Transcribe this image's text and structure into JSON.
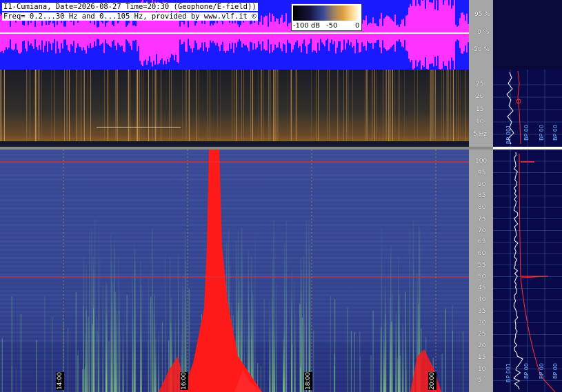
{
  "header": {
    "title_line1": "I1-Cumiana, Date=2026-08-27 Time=20:30 (Geophone/E-field))",
    "title_line2": "Freq= 0.2...30 Hz and 0...105 Hz, provided by www.vlf.it ©"
  },
  "colorbar": {
    "labels": [
      "-100 dB",
      "-50",
      "0"
    ]
  },
  "top_axis": {
    "ticks": [
      "95 %",
      "0 %",
      "-50 %"
    ]
  },
  "low_axis": {
    "ticks": [
      "25",
      "20",
      "15",
      "10",
      "5 Hz"
    ]
  },
  "high_axis": {
    "ticks": [
      "100",
      "95",
      "90",
      "85",
      "80",
      "75",
      "70",
      "65",
      "60",
      "55",
      "50",
      "45",
      "40",
      "35",
      "30",
      "25",
      "20",
      "15",
      "10",
      "5"
    ]
  },
  "time_axis": {
    "labels": [
      "14:00",
      "16:00",
      "18:00",
      "20:00"
    ]
  },
  "side_panel": {
    "low_labels": [
      "BP 001",
      "BP 00",
      "BP 00",
      "BP 00"
    ],
    "high_labels": [
      "BP 001",
      "BP 00",
      "BP 00",
      "BP 00"
    ]
  },
  "colors": {
    "top_strip": "#1a1aff",
    "magenta": "#ff33ff",
    "red_line": "#ff2020",
    "spectrogram_base": "#2f3f8c",
    "axis_gray": "#a6a6a6"
  }
}
